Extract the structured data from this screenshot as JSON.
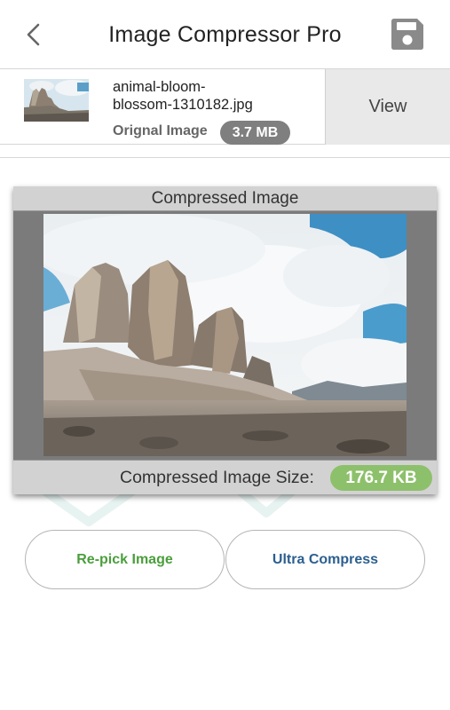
{
  "header": {
    "title": "Image Compressor Pro",
    "back_icon": "chevron-left-icon",
    "save_icon": "floppy-disk-icon"
  },
  "original": {
    "file_name_line1": "animal-bloom-",
    "file_name_line2": "blossom-1310182.jpg",
    "label": "Orignal Image",
    "size": "3.7 MB",
    "view_label": "View"
  },
  "compressed": {
    "title": "Compressed Image",
    "size_label": "Compressed Image Size:",
    "size": "176.7 KB"
  },
  "actions": {
    "repick_label": "Re-pick Image",
    "ultra_label": "Ultra Compress"
  },
  "colors": {
    "size_badge_green": "#8dc06b",
    "original_size_gray": "#7f7f7f",
    "repick_text": "#4b9e3c",
    "ultra_text": "#2b5f8f"
  }
}
